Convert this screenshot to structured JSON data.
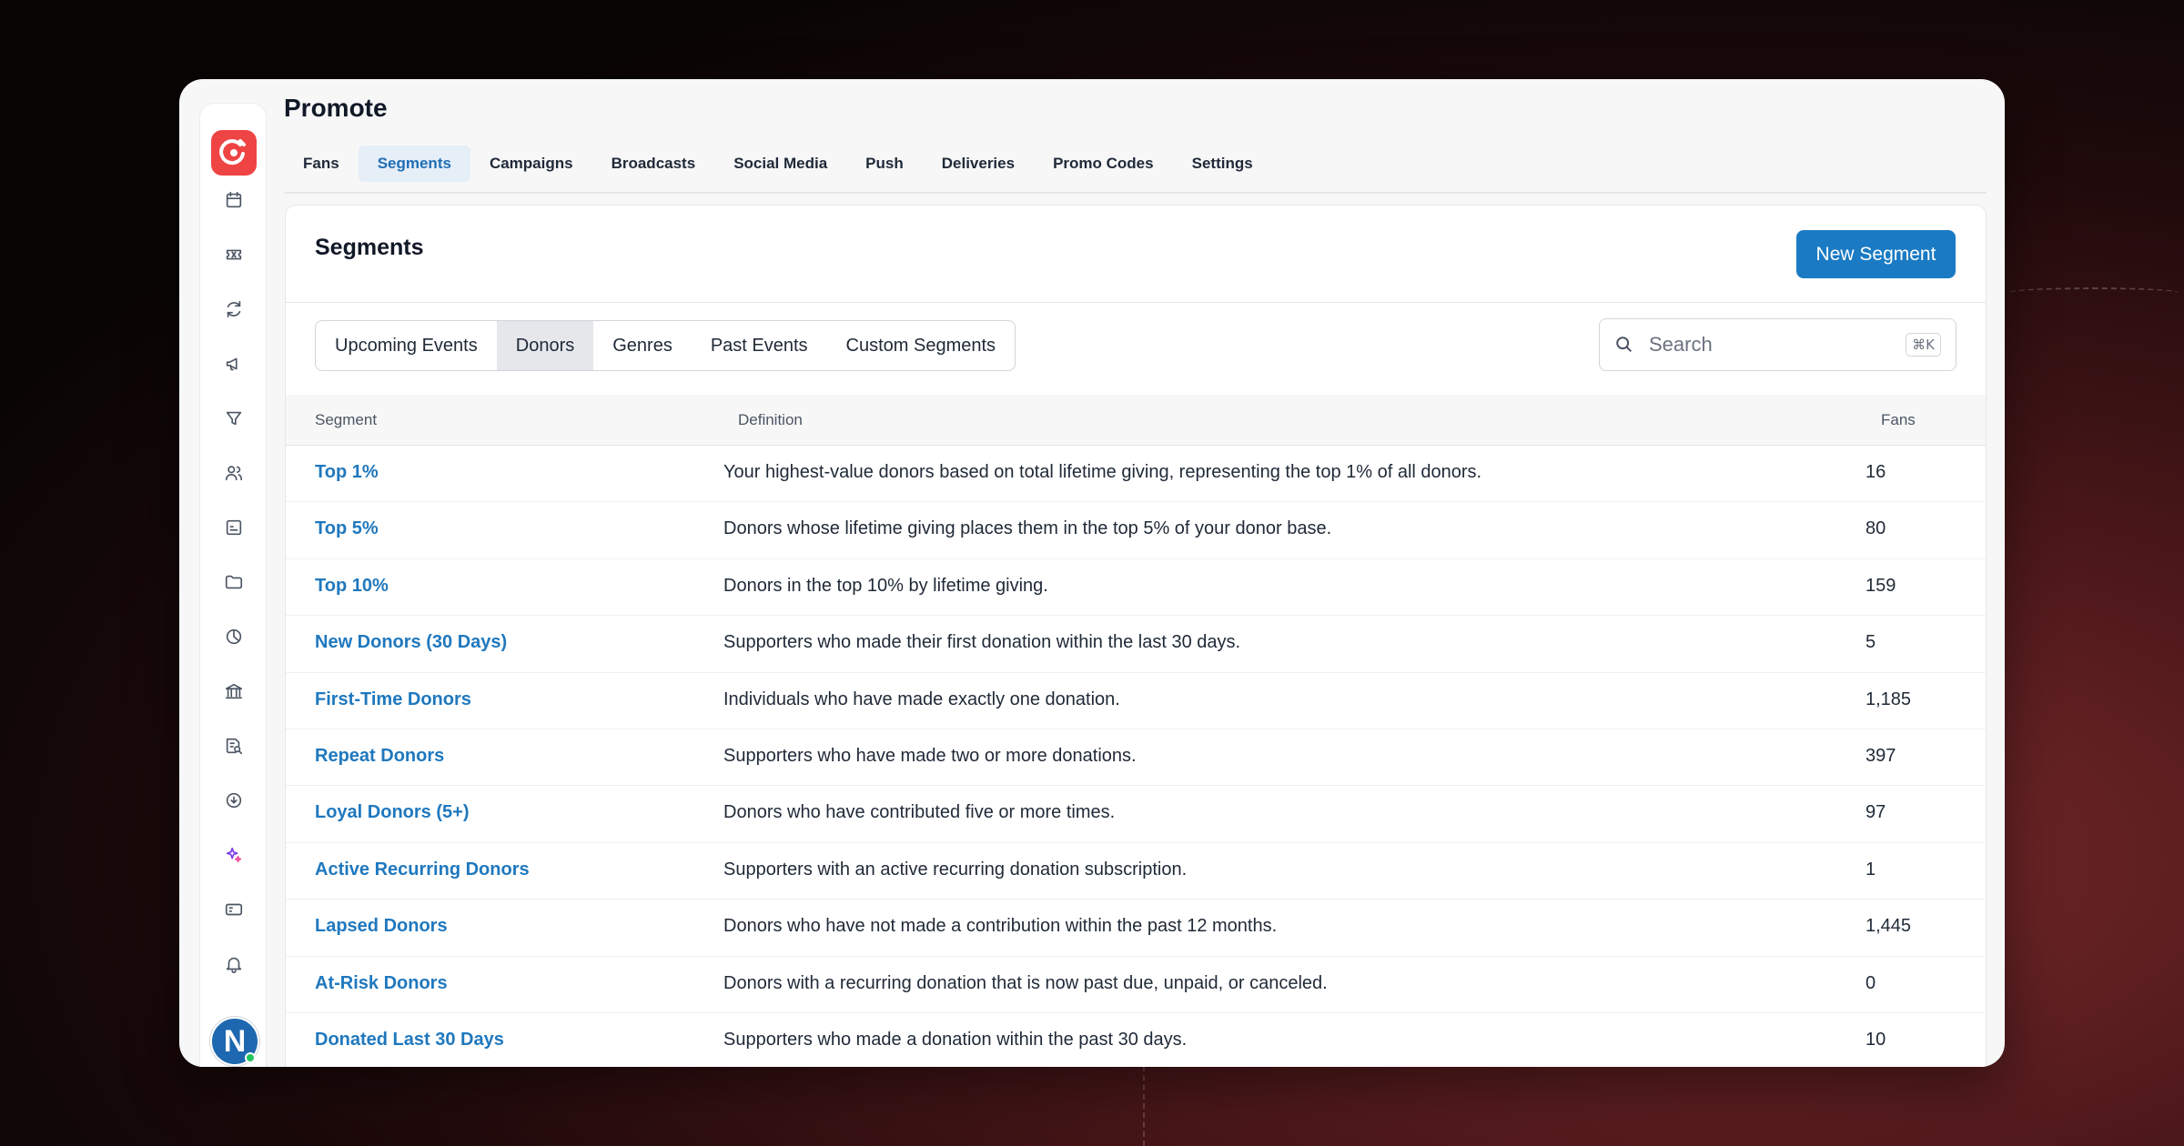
{
  "app": {
    "title": "Promote",
    "avatar_initial": "N"
  },
  "top_tabs": [
    {
      "label": "Fans",
      "active": false
    },
    {
      "label": "Segments",
      "active": true
    },
    {
      "label": "Campaigns",
      "active": false
    },
    {
      "label": "Broadcasts",
      "active": false
    },
    {
      "label": "Social Media",
      "active": false
    },
    {
      "label": "Push",
      "active": false
    },
    {
      "label": "Deliveries",
      "active": false
    },
    {
      "label": "Promo Codes",
      "active": false
    },
    {
      "label": "Settings",
      "active": false
    }
  ],
  "sidebar_icons": [
    "calendar-icon",
    "ticket-icon",
    "refresh-icon",
    "megaphone-icon",
    "filter-icon",
    "users-icon",
    "image-icon",
    "folder-icon",
    "pie-chart-icon",
    "bank-icon",
    "report-search-icon",
    "download-icon",
    "sparkles-icon",
    "tag-card-icon",
    "bell-icon"
  ],
  "card": {
    "title": "Segments",
    "new_button": "New Segment",
    "search_placeholder": "Search",
    "search_shortcut": "⌘K"
  },
  "segment_tabs": [
    {
      "label": "Upcoming Events",
      "active": false
    },
    {
      "label": "Donors",
      "active": true
    },
    {
      "label": "Genres",
      "active": false
    },
    {
      "label": "Past Events",
      "active": false
    },
    {
      "label": "Custom Segments",
      "active": false
    }
  ],
  "table": {
    "headers": {
      "segment": "Segment",
      "definition": "Definition",
      "fans": "Fans"
    },
    "rows": [
      {
        "name": "Top 1%",
        "definition": "Your highest-value donors based on total lifetime giving, representing the top 1% of all donors.",
        "fans": "16"
      },
      {
        "name": "Top 5%",
        "definition": "Donors whose lifetime giving places them in the top 5% of your donor base.",
        "fans": "80"
      },
      {
        "name": "Top 10%",
        "definition": "Donors in the top 10% by lifetime giving.",
        "fans": "159"
      },
      {
        "name": "New Donors (30 Days)",
        "definition": "Supporters who made their first donation within the last 30 days.",
        "fans": "5"
      },
      {
        "name": "First-Time Donors",
        "definition": "Individuals who have made exactly one donation.",
        "fans": "1,185"
      },
      {
        "name": "Repeat Donors",
        "definition": "Supporters who have made two or more donations.",
        "fans": "397"
      },
      {
        "name": "Loyal Donors (5+)",
        "definition": "Donors who have contributed five or more times.",
        "fans": "97"
      },
      {
        "name": "Active Recurring Donors",
        "definition": "Supporters with an active recurring donation subscription.",
        "fans": "1"
      },
      {
        "name": "Lapsed Donors",
        "definition": "Donors who have not made a contribution within the past 12 months.",
        "fans": "1,445"
      },
      {
        "name": "At-Risk Donors",
        "definition": "Donors with a recurring donation that is now past due, unpaid, or canceled.",
        "fans": "0"
      },
      {
        "name": "Donated Last 30 Days",
        "definition": "Supporters who made a donation within the past 30 days.",
        "fans": "10"
      }
    ]
  },
  "colors": {
    "accent": "#1a7bc4",
    "brand": "#ef4444",
    "link": "#1f78be"
  }
}
